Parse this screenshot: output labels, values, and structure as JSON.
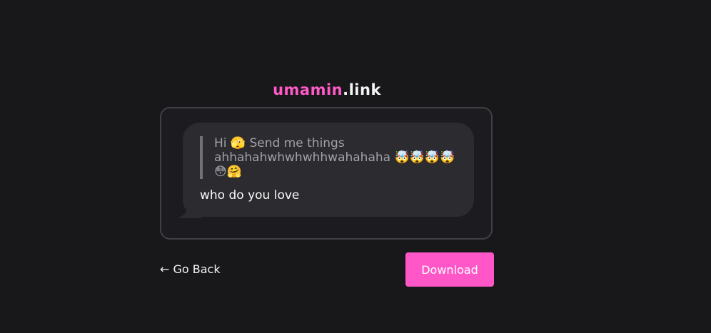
{
  "logo": {
    "brand": "umamin",
    "tld": ".link"
  },
  "message": {
    "prompt": "Hi 🫣 Send me things ahhahahwhwhwhhwahahaha 🤯🤯🤯🤯😳🤗",
    "reply": "who do you love"
  },
  "actions": {
    "back_label": "← Go Back",
    "download_label": "Download"
  },
  "colors": {
    "background": "#18181b",
    "brand": "#ff5ac8",
    "button": "#ff57c7",
    "bubble": "#2b2b30"
  }
}
